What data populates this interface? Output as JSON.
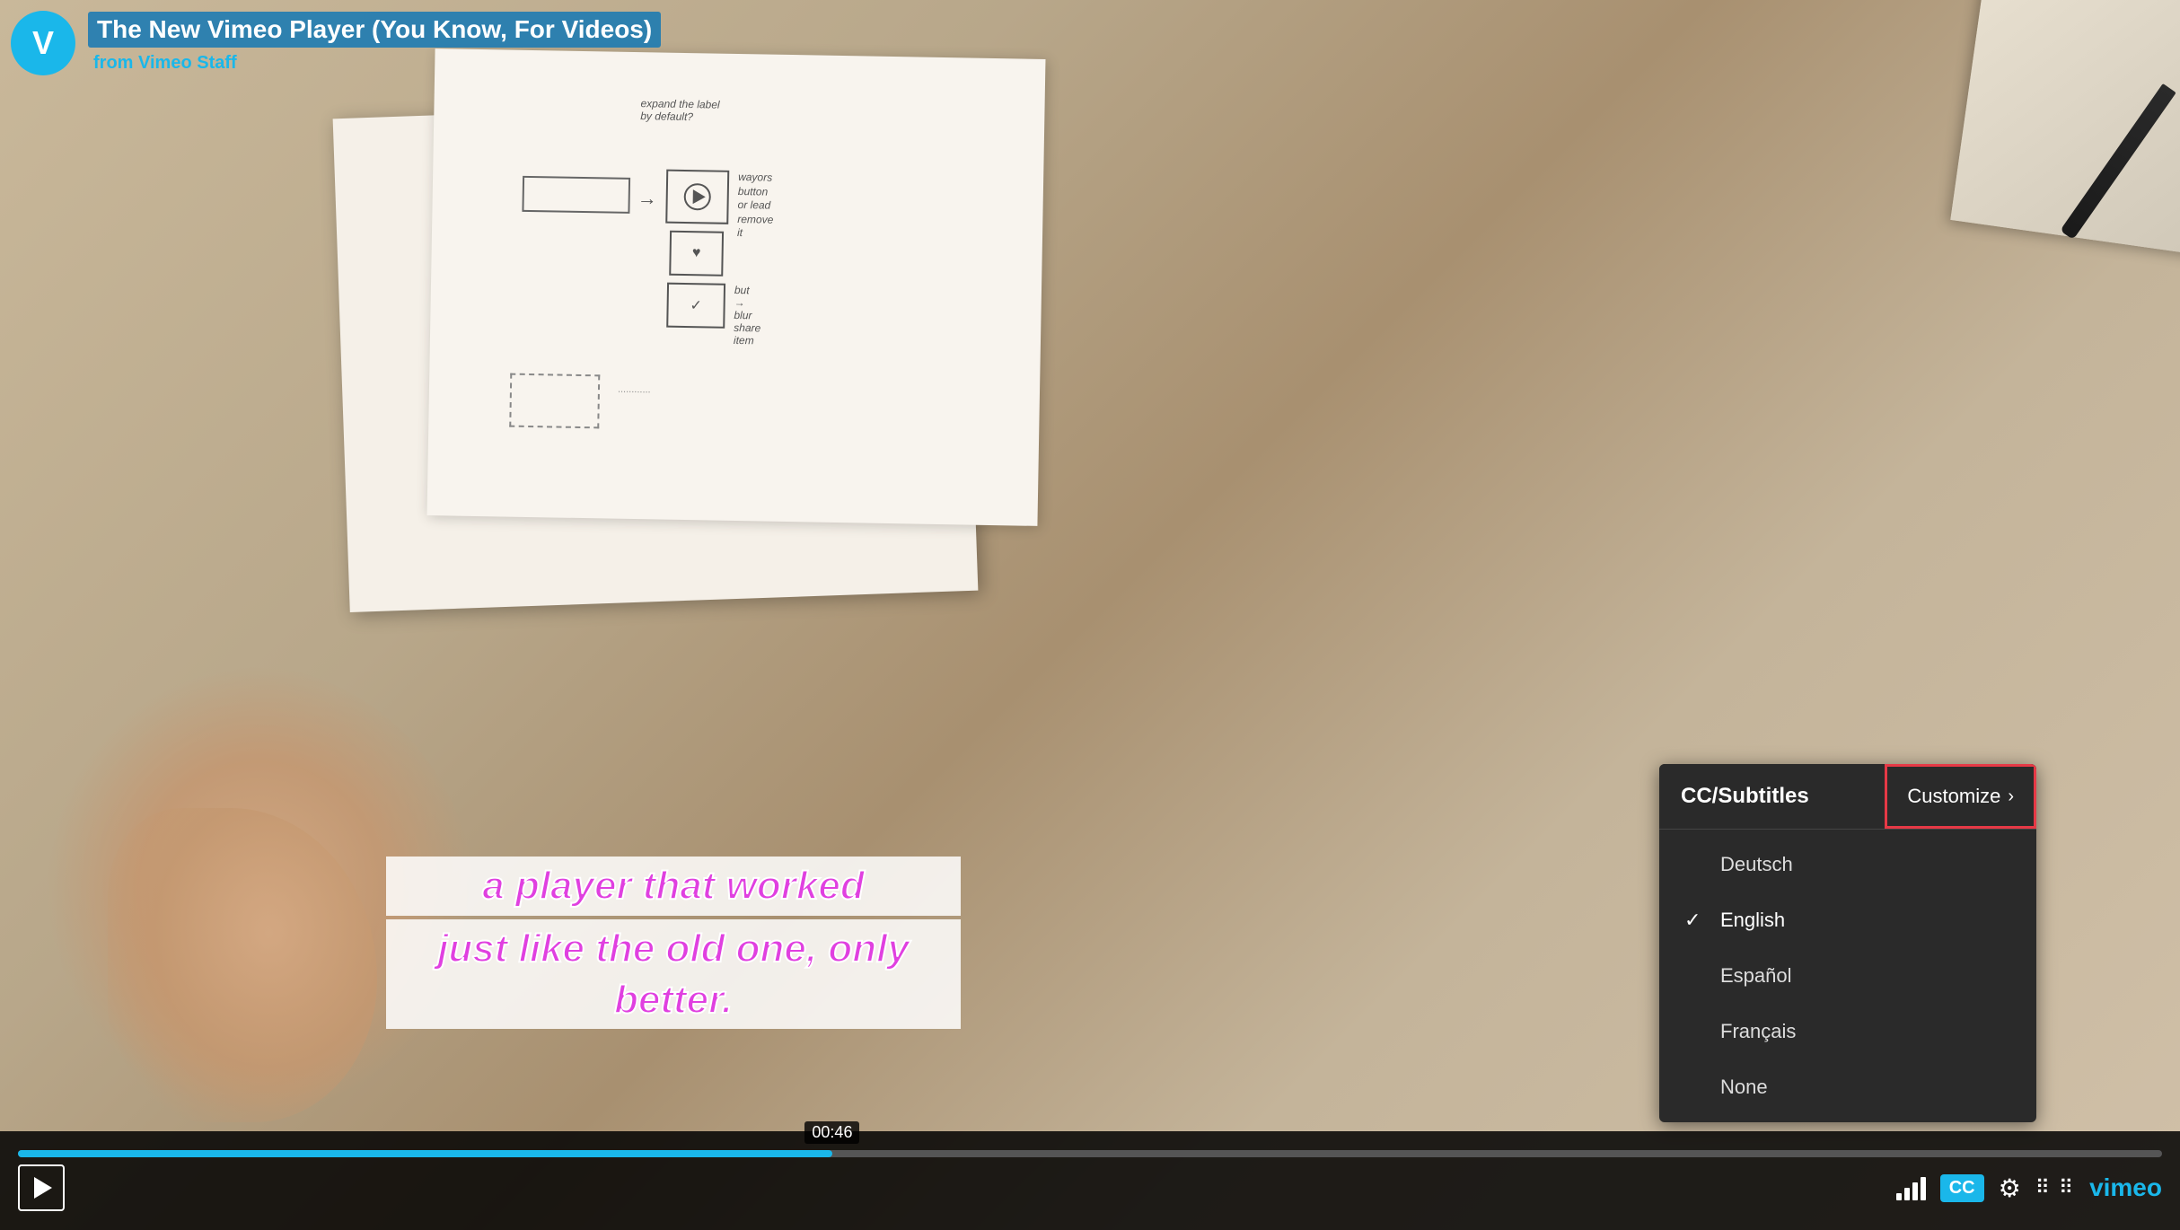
{
  "video": {
    "title": "The New Vimeo Player (You Know, For Videos)",
    "from_label": "from",
    "channel": "Vimeo Staff",
    "vimeo_logo": "V"
  },
  "subtitle": {
    "line1": "a player that worked",
    "line2": "just like the old one, only better."
  },
  "controls": {
    "play_label": "▶",
    "time_badge": "00:46",
    "progress_percent": 38,
    "cc_label": "CC",
    "settings_label": "⚙",
    "grid_label": "⠿ ⠿",
    "vimeo_label": "vimeo"
  },
  "cc_panel": {
    "title": "CC/Subtitles",
    "customize_label": "Customize",
    "customize_arrow": "›",
    "options": [
      {
        "id": "deutsch",
        "label": "Deutsch",
        "selected": false
      },
      {
        "id": "english",
        "label": "English",
        "selected": true
      },
      {
        "id": "espanol",
        "label": "Español",
        "selected": false
      },
      {
        "id": "francais",
        "label": "Français",
        "selected": false
      },
      {
        "id": "none",
        "label": "None",
        "selected": false
      }
    ]
  }
}
